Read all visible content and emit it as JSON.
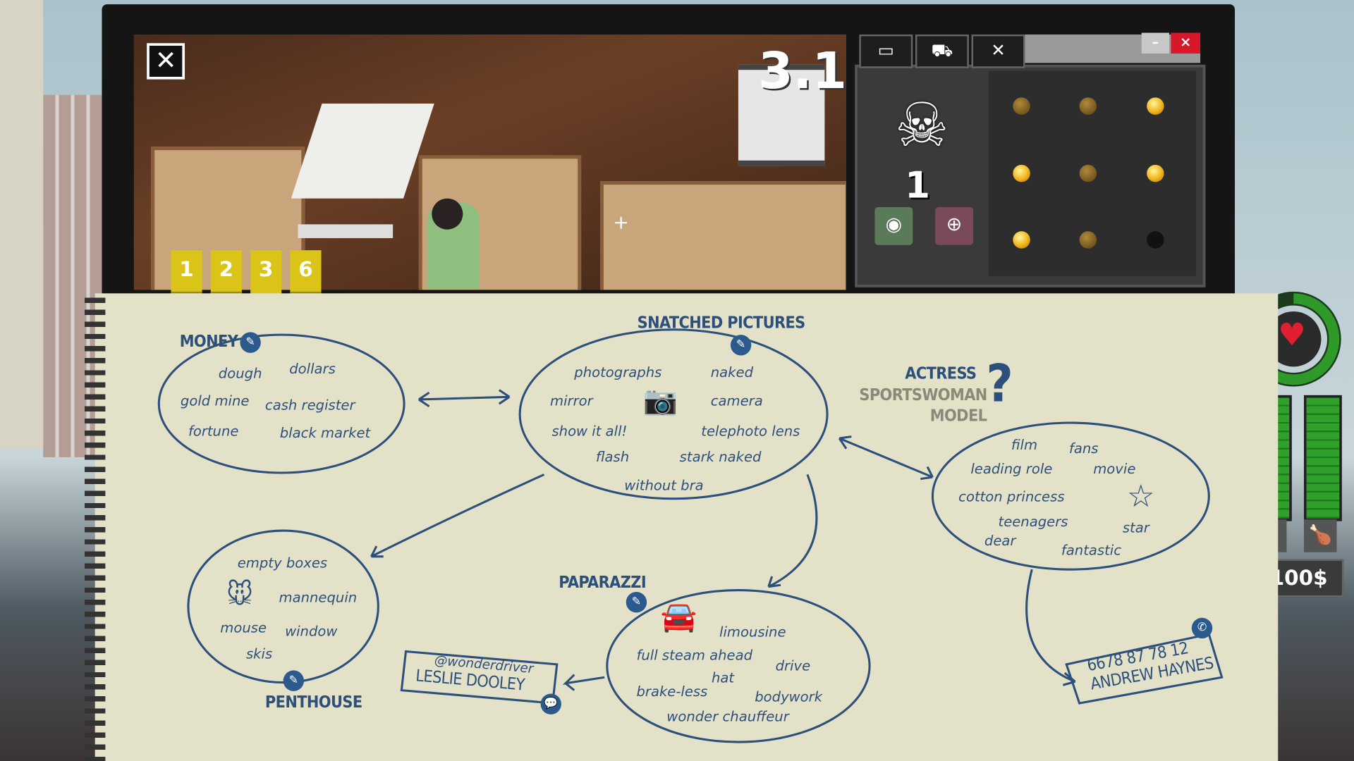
{
  "viewfinder": {
    "close_icon": "close-x-icon",
    "timer": "3.1",
    "photo_tags": [
      "1",
      "2",
      "3",
      "6"
    ]
  },
  "panel": {
    "tabs": [
      {
        "icon": "camera-icon"
      },
      {
        "icon": "cart-icon"
      },
      {
        "icon": "close-x-icon"
      }
    ],
    "window_buttons": {
      "minimize": "–",
      "close": "×"
    },
    "rank_emblem": "skull-emblem-icon",
    "rank_level": "1",
    "locked_buttons": [
      {
        "icon": "eye-icon",
        "color": "#5a7a5a"
      },
      {
        "icon": "plus-icon",
        "color": "#7a4a5a"
      }
    ],
    "orbs": [
      "dim",
      "dim",
      "lit",
      "lit",
      "dim",
      "lit",
      "lit",
      "dim",
      "empty"
    ]
  },
  "status": {
    "health_icon": "heart-icon",
    "health_fraction": 0.9,
    "sleep_icon": "zzz-icon",
    "food_icon": "drumstick-icon",
    "money": "100$"
  },
  "notebook": {
    "money": {
      "title": "MONEY",
      "words": [
        "dough",
        "dollars",
        "gold mine",
        "cash register",
        "fortune",
        "black market"
      ]
    },
    "snatched": {
      "title": "SNATCHED PICTURES",
      "words": [
        "photographs",
        "naked",
        "mirror",
        "camera",
        "show it all!",
        "telephoto lens",
        "flash",
        "stark naked",
        "without bra"
      ]
    },
    "actress": {
      "titles": [
        "ACTRESS",
        "SPORTSWOMAN",
        "MODEL"
      ],
      "question": "?",
      "words": [
        "film",
        "fans",
        "leading role",
        "movie",
        "cotton princess",
        "teenagers",
        "star",
        "dear",
        "fantastic"
      ]
    },
    "penthouse": {
      "title": "PENTHOUSE",
      "words": [
        "empty boxes",
        "mannequin",
        "mouse",
        "window",
        "skis"
      ]
    },
    "paparazzi": {
      "title": "PAPARAZZI",
      "words": [
        "limousine",
        "full steam ahead",
        "drive",
        "hat",
        "brake-less",
        "bodywork",
        "wonder chauffeur"
      ]
    },
    "contact_leslie": {
      "handle": "@wonderdriver",
      "name": "LESLIE DOOLEY"
    },
    "contact_andrew": {
      "phone": "6678 87 78 12",
      "name": "ANDREW HAYNES"
    }
  }
}
